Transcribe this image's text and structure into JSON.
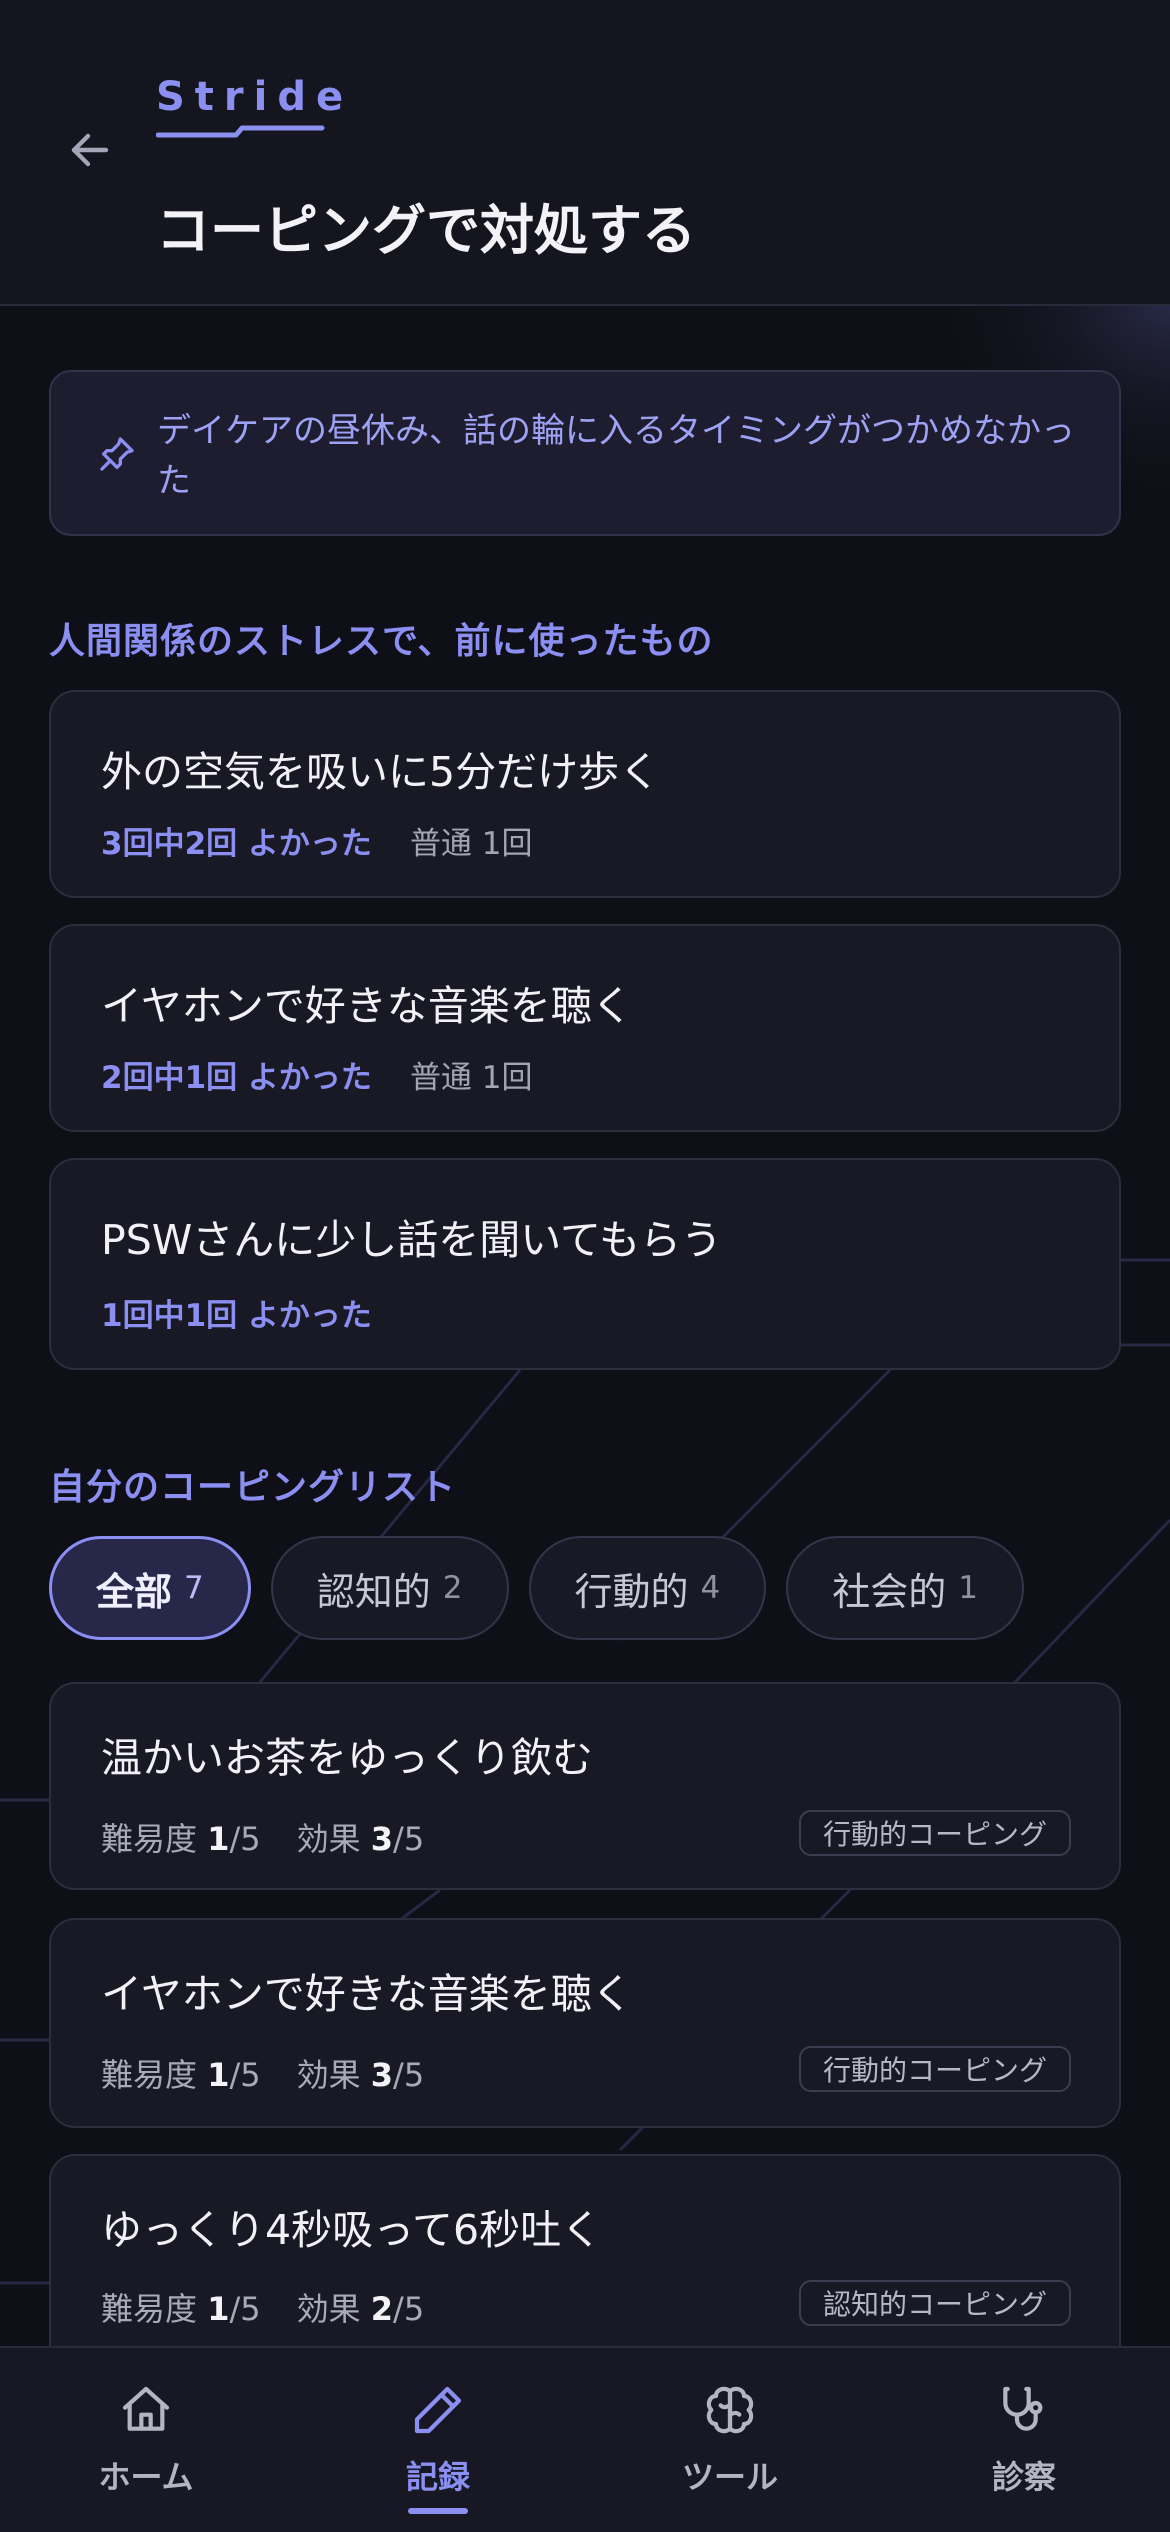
{
  "header": {
    "logo": "Stride",
    "title": "コーピングで対処する",
    "back_icon": "arrow-left-icon"
  },
  "context": {
    "icon": "pin-icon",
    "text": "デイケアの昼休み、話の輪に入るタイミングがつかめなかった"
  },
  "past_section": {
    "label": "人間関係のストレスで、前に使ったもの",
    "items": [
      {
        "title": "外の空気を吸いに5分だけ歩く",
        "good": "3回中2回 よかった",
        "neutral": "普通 1回"
      },
      {
        "title": "イヤホンで好きな音楽を聴く",
        "good": "2回中1回 よかった",
        "neutral": "普通 1回"
      },
      {
        "title": "PSWさんに少し話を聞いてもらう",
        "good": "1回中1回 よかった",
        "neutral": ""
      }
    ]
  },
  "list_section": {
    "label": "自分のコーピングリスト",
    "filters": [
      {
        "label": "全部",
        "count": "7",
        "active": true
      },
      {
        "label": "認知的",
        "count": "2",
        "active": false
      },
      {
        "label": "行動的",
        "count": "4",
        "active": false
      },
      {
        "label": "社会的",
        "count": "1",
        "active": false
      }
    ],
    "items": [
      {
        "title": "温かいお茶をゆっくり飲む",
        "difficulty_label": "難易度",
        "difficulty": "1",
        "effect_label": "効果",
        "effect": "3",
        "scale": "/5",
        "tag": "行動的コーピング"
      },
      {
        "title": "イヤホンで好きな音楽を聴く",
        "difficulty_label": "難易度",
        "difficulty": "1",
        "effect_label": "効果",
        "effect": "3",
        "scale": "/5",
        "tag": "行動的コーピング"
      },
      {
        "title": "ゆっくり4秒吸って6秒吐く",
        "difficulty_label": "難易度",
        "difficulty": "1",
        "effect_label": "効果",
        "effect": "2",
        "scale": "/5",
        "tag": "認知的コーピング"
      }
    ]
  },
  "nav": {
    "items": [
      {
        "label": "ホーム",
        "icon": "home-icon",
        "active": false
      },
      {
        "label": "記録",
        "icon": "pencil-icon",
        "active": true
      },
      {
        "label": "ツール",
        "icon": "brain-icon",
        "active": false
      },
      {
        "label": "診察",
        "icon": "stethoscope-icon",
        "active": false
      }
    ]
  },
  "colors": {
    "accent": "#8b8ff2",
    "background": "#0f1017",
    "card": "#181925"
  }
}
